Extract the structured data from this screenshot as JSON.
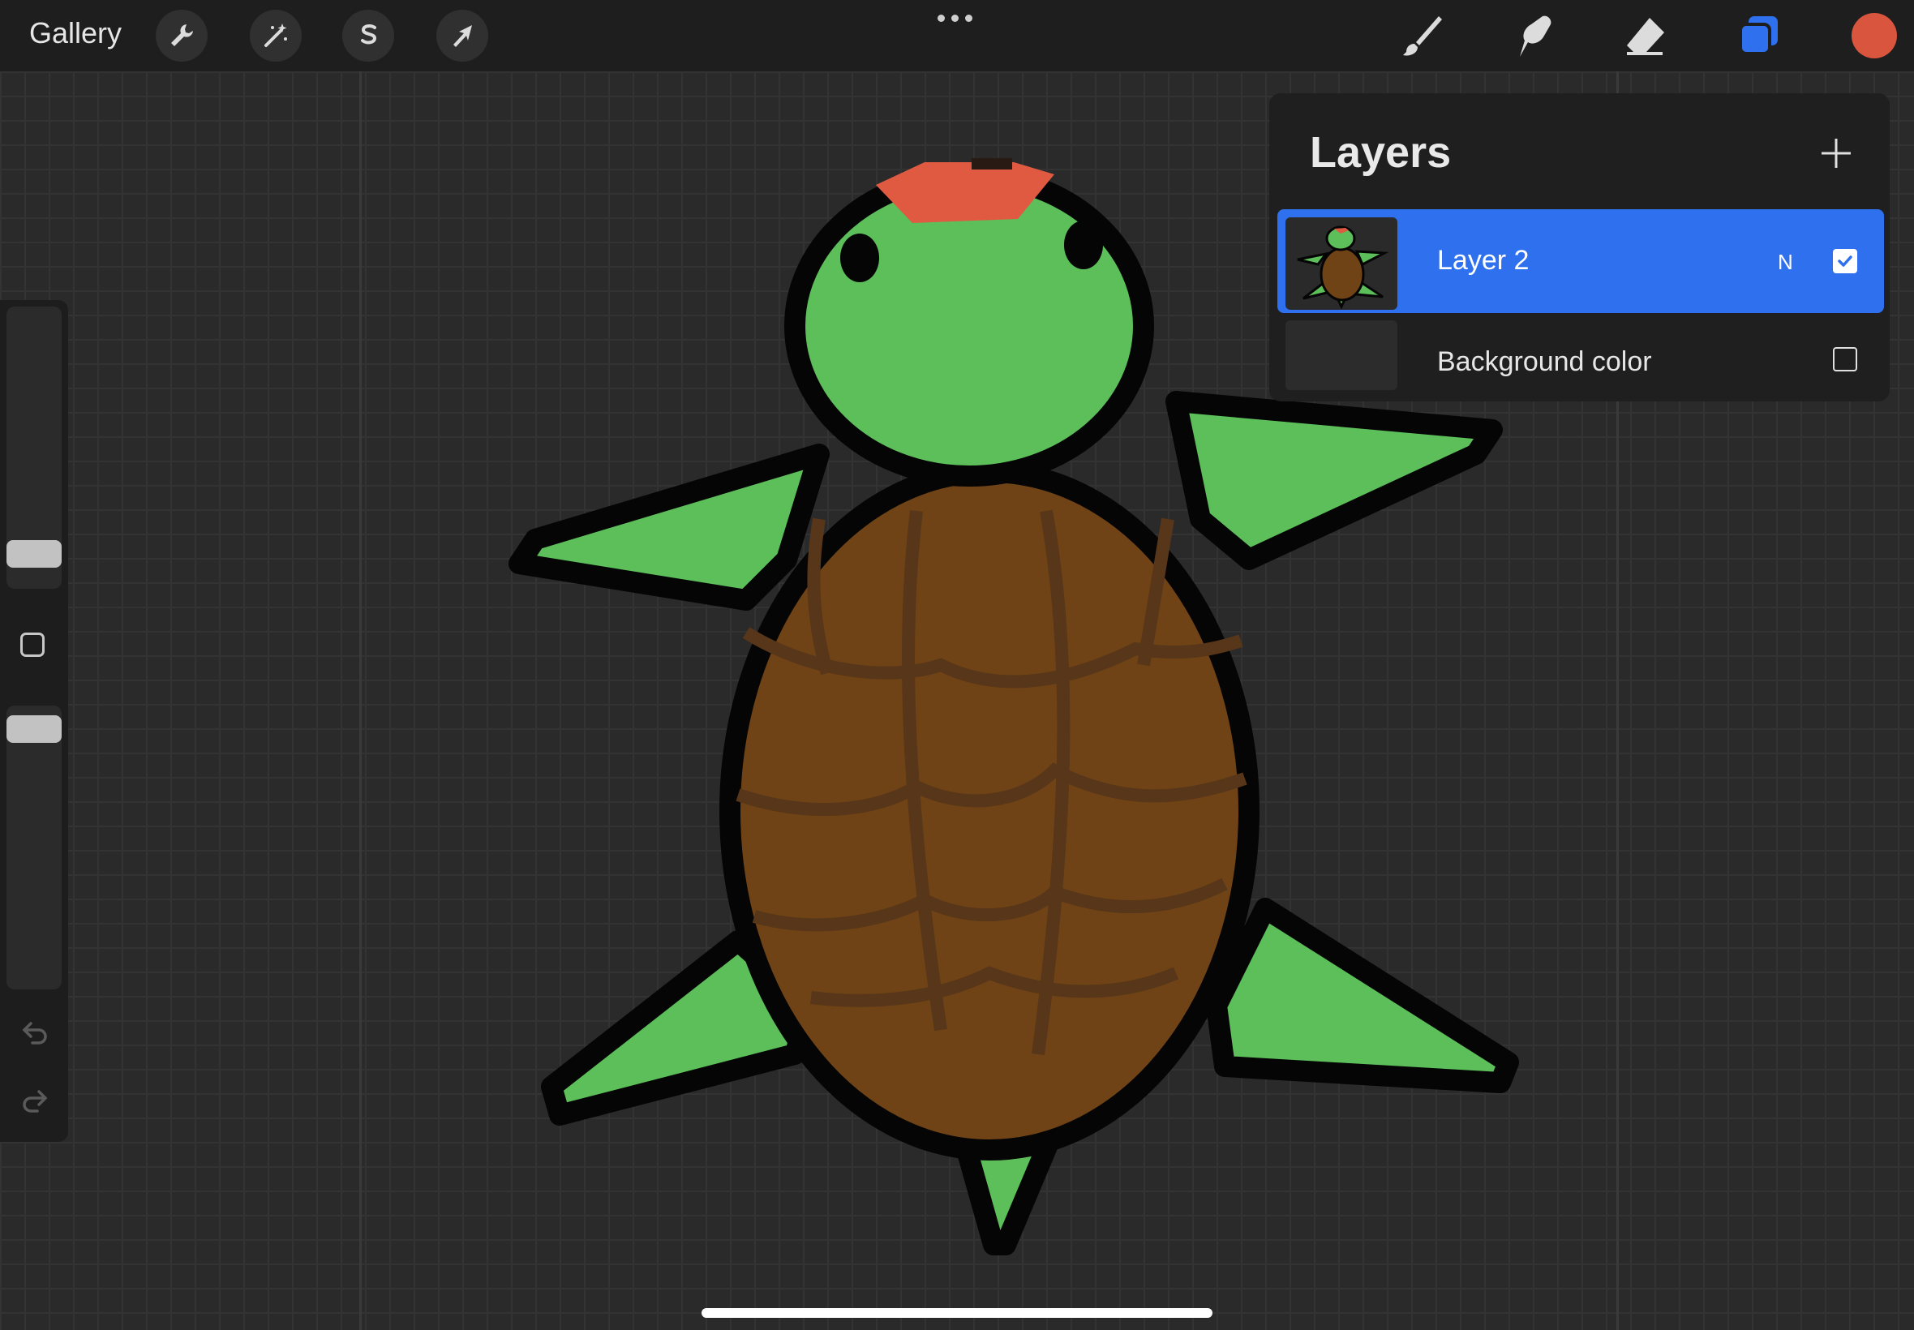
{
  "topbar": {
    "gallery_label": "Gallery",
    "left_tools": [
      "wrench-icon",
      "magic-wand-icon",
      "selection-s-icon",
      "arrow-transform-icon"
    ],
    "right_tools": [
      "brush-icon",
      "smudge-icon",
      "eraser-icon",
      "layers-icon"
    ],
    "current_color": "#d9553e"
  },
  "layers": {
    "title": "Layers",
    "items": [
      {
        "name": "Layer 2",
        "blend_mode": "N",
        "visible": true,
        "active": true
      },
      {
        "name": "Background color",
        "visible": false,
        "active": false
      }
    ]
  },
  "colors": {
    "accent": "#2f70ef",
    "shell": "#6f4316",
    "shell_lines": "#573619",
    "skin": "#5cbf5a",
    "outline": "#050505",
    "hat": "#e05a42"
  }
}
